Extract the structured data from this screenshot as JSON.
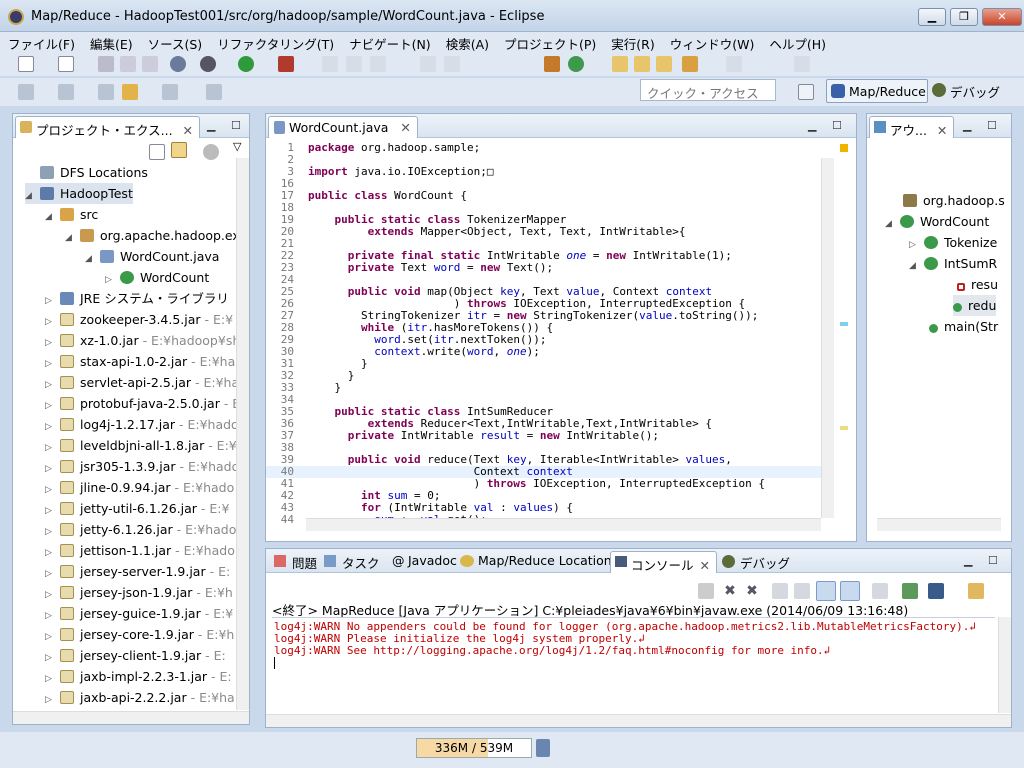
{
  "window": {
    "title": "Map/Reduce - HadoopTest001/src/org/hadoop/sample/WordCount.java - Eclipse",
    "minimize": "▁",
    "maximize": "❐",
    "close": "✕"
  },
  "menu": [
    "ファイル(F)",
    "編集(E)",
    "ソース(S)",
    "リファクタリング(T)",
    "ナビゲート(N)",
    "検索(A)",
    "プロジェクト(P)",
    "実行(R)",
    "ウィンドウ(W)",
    "ヘルプ(H)"
  ],
  "toolbar": {
    "quick_access_placeholder": "クイック・アクセス",
    "perspective_active": "Map/Reduce",
    "perspective_other": "デバッグ"
  },
  "package_explorer": {
    "title": "プロジェクト・エクス...",
    "items": [
      {
        "label": "DFS Locations",
        "suffix": ""
      },
      {
        "label": "HadoopTest",
        "suffix": ""
      },
      {
        "label": "src",
        "suffix": ""
      },
      {
        "label": "org.apache.hadoop.ex",
        "suffix": ""
      },
      {
        "label": "WordCount.java",
        "suffix": ""
      },
      {
        "label": "WordCount",
        "suffix": ""
      },
      {
        "label": "JRE システム・ライブラリ",
        "suffix": ""
      },
      {
        "label": "zookeeper-3.4.5.jar",
        "suffix": " - E:¥"
      },
      {
        "label": "xz-1.0.jar",
        "suffix": " - E:¥hadoop¥sh"
      },
      {
        "label": "stax-api-1.0-2.jar",
        "suffix": " - E:¥ha"
      },
      {
        "label": "servlet-api-2.5.jar",
        "suffix": " - E:¥ha"
      },
      {
        "label": "protobuf-java-2.5.0.jar",
        "suffix": " - E:"
      },
      {
        "label": "log4j-1.2.17.jar",
        "suffix": " - E:¥hado"
      },
      {
        "label": "leveldbjni-all-1.8.jar",
        "suffix": " - E:¥"
      },
      {
        "label": "jsr305-1.3.9.jar",
        "suffix": " - E:¥hado"
      },
      {
        "label": "jline-0.9.94.jar",
        "suffix": " - E:¥hado"
      },
      {
        "label": "jetty-util-6.1.26.jar",
        "suffix": " - E:¥"
      },
      {
        "label": "jetty-6.1.26.jar",
        "suffix": " - E:¥hado"
      },
      {
        "label": "jettison-1.1.jar",
        "suffix": " - E:¥hado"
      },
      {
        "label": "jersey-server-1.9.jar",
        "suffix": " - E:"
      },
      {
        "label": "jersey-json-1.9.jar",
        "suffix": " - E:¥h"
      },
      {
        "label": "jersey-guice-1.9.jar",
        "suffix": " - E:¥"
      },
      {
        "label": "jersey-core-1.9.jar",
        "suffix": " - E:¥h"
      },
      {
        "label": "jersey-client-1.9.jar",
        "suffix": " - E:"
      },
      {
        "label": "jaxb-impl-2.2.3-1.jar",
        "suffix": " - E:"
      },
      {
        "label": "jaxb-api-2.2.2.jar",
        "suffix": " - E:¥ha"
      }
    ]
  },
  "editor": {
    "tab": "WordCount.java",
    "lines": [
      {
        "n": "1",
        "t": "package org.hadoop.sample;"
      },
      {
        "n": "2",
        "t": ""
      },
      {
        "n": "3",
        "t": "import java.io.IOException;□"
      },
      {
        "n": "16",
        "t": ""
      },
      {
        "n": "17",
        "t": "public class WordCount {"
      },
      {
        "n": "18",
        "t": ""
      },
      {
        "n": "19",
        "t": "    public static class TokenizerMapper"
      },
      {
        "n": "20",
        "t": "         extends Mapper<Object, Text, Text, IntWritable>{"
      },
      {
        "n": "21",
        "t": ""
      },
      {
        "n": "22",
        "t": "      private final static IntWritable one = new IntWritable(1);"
      },
      {
        "n": "23",
        "t": "      private Text word = new Text();"
      },
      {
        "n": "24",
        "t": ""
      },
      {
        "n": "25",
        "t": "      public void map(Object key, Text value, Context context"
      },
      {
        "n": "26",
        "t": "                      ) throws IOException, InterruptedException {"
      },
      {
        "n": "27",
        "t": "        StringTokenizer itr = new StringTokenizer(value.toString());"
      },
      {
        "n": "28",
        "t": "        while (itr.hasMoreTokens()) {"
      },
      {
        "n": "29",
        "t": "          word.set(itr.nextToken());"
      },
      {
        "n": "30",
        "t": "          context.write(word, one);"
      },
      {
        "n": "31",
        "t": "        }"
      },
      {
        "n": "32",
        "t": "      }"
      },
      {
        "n": "33",
        "t": "    }"
      },
      {
        "n": "34",
        "t": ""
      },
      {
        "n": "35",
        "t": "    public static class IntSumReducer"
      },
      {
        "n": "36",
        "t": "         extends Reducer<Text,IntWritable,Text,IntWritable> {"
      },
      {
        "n": "37",
        "t": "      private IntWritable result = new IntWritable();"
      },
      {
        "n": "38",
        "t": ""
      },
      {
        "n": "39",
        "t": "      public void reduce(Text key, Iterable<IntWritable> values,"
      },
      {
        "n": "40",
        "t": "                         Context context"
      },
      {
        "n": "41",
        "t": "                         ) throws IOException, InterruptedException {"
      },
      {
        "n": "42",
        "t": "        int sum = 0;"
      },
      {
        "n": "43",
        "t": "        for (IntWritable val : values) {"
      },
      {
        "n": "44",
        "t": "          sum += val.get();"
      }
    ]
  },
  "outline": {
    "title": "アウ...",
    "items": [
      "org.hadoop.s",
      "WordCount",
      "Tokenize",
      "IntSumR",
      "resu",
      "redu",
      "main(Str"
    ]
  },
  "console": {
    "tabs": [
      "問題",
      "タスク",
      "Javadoc",
      "Map/Reduce Locations",
      "コンソール",
      "デバッグ"
    ],
    "header": "<終了> MapReduce [Java アプリケーション] C:¥pleiades¥java¥6¥bin¥javaw.exe (2014/06/09 13:16:48)",
    "lines": [
      "log4j:WARN No appenders could be found for logger (org.apache.hadoop.metrics2.lib.MutableMetricsFactory).↲",
      "log4j:WARN Please initialize the log4j system properly.↲",
      "log4j:WARN See http://logging.apache.org/log4j/1.2/faq.html#noconfig for more info.↲"
    ]
  },
  "status": {
    "heap": "336M / 539M",
    "heap_used": 336,
    "heap_total": 539
  }
}
